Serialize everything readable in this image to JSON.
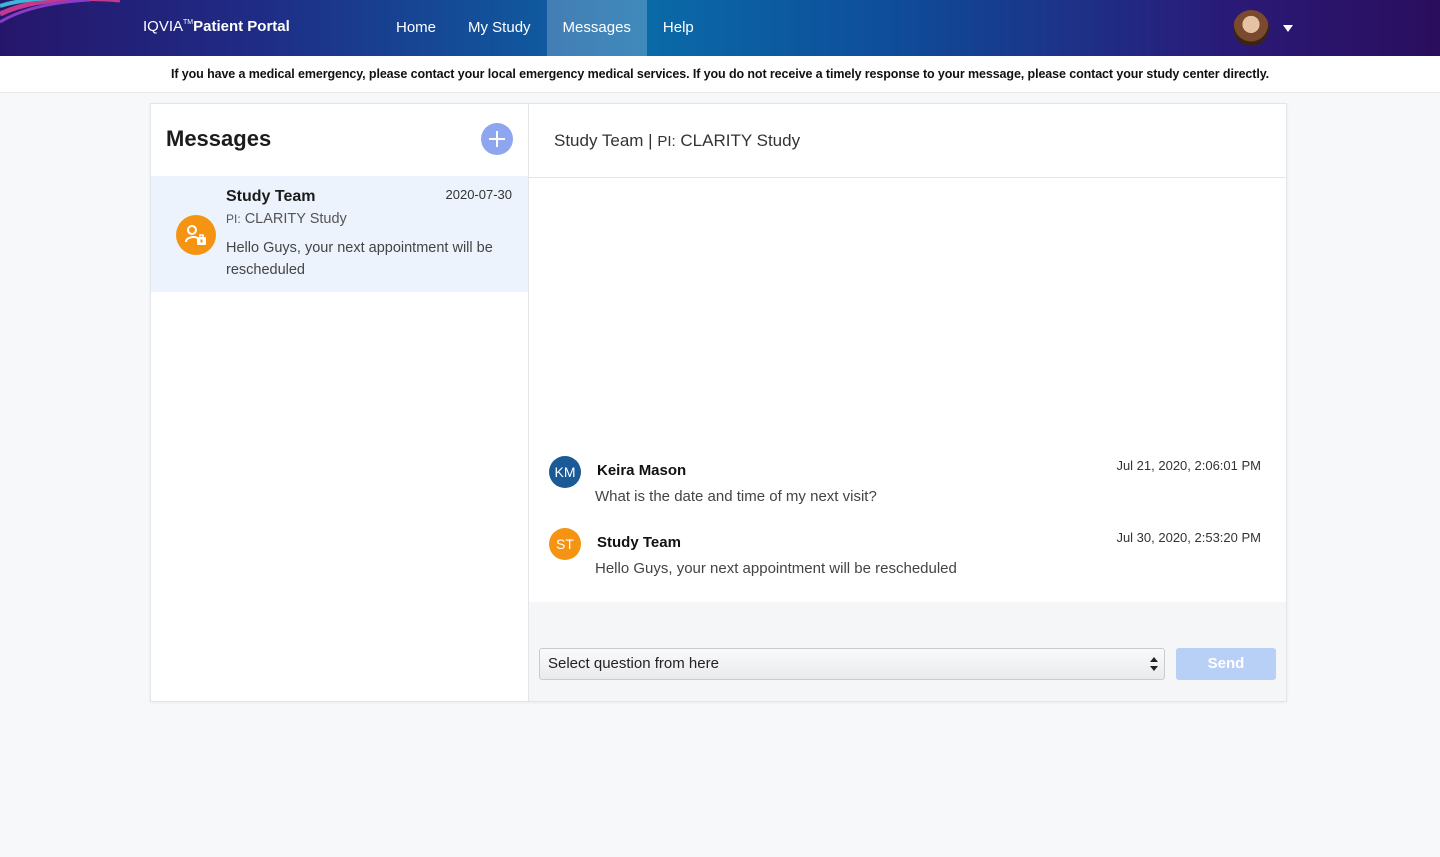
{
  "app": {
    "brand_name": "IQVIA",
    "brand_tm": "TM",
    "brand_product": "Patient Portal"
  },
  "nav": {
    "items": [
      {
        "label": "Home",
        "active": false
      },
      {
        "label": "My Study",
        "active": false
      },
      {
        "label": "Messages",
        "active": true
      },
      {
        "label": "Help",
        "active": false
      }
    ]
  },
  "user_menu": {
    "avatar_icon": "user-photo",
    "caret_icon": "caret-down-icon"
  },
  "notice": {
    "text": "If you have a medical emergency, please contact your local emergency medical services. If you do not receive a timely response to your message, please contact your study center directly."
  },
  "messages_panel": {
    "title": "Messages",
    "new_message_icon": "plus-icon",
    "threads": [
      {
        "name": "Study Team",
        "date": "2020-07-30",
        "pi_label": "PI:",
        "study": "CLARITY Study",
        "preview": "Hello Guys, your next appointment will be rescheduled",
        "icon": "study-team-icon",
        "icon_color": "#f59313"
      }
    ]
  },
  "conversation": {
    "title_team": "Study Team | ",
    "title_pi": "PI:",
    "title_study": "CLARITY Study",
    "messages": [
      {
        "initials": "KM",
        "avatar_color": "#1a5a96",
        "sender": "Keira Mason",
        "time": "Jul 21, 2020, 2:06:01 PM",
        "text": "What is the date and time of my next visit?"
      },
      {
        "initials": "ST",
        "avatar_color": "#f59313",
        "sender": "Study Team",
        "time": "Jul 30, 2020, 2:53:20 PM",
        "text": "Hello Guys, your next appointment will be rescheduled"
      }
    ]
  },
  "composer": {
    "select_value": "Select question from here",
    "send_label": "Send"
  }
}
